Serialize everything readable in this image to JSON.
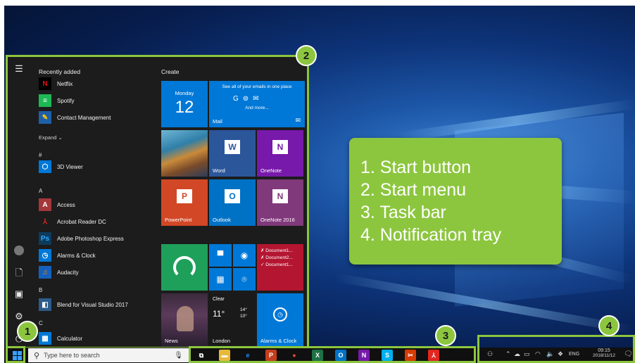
{
  "start_menu": {
    "recently_added": "Recently added",
    "create": "Create",
    "expand": "Expand",
    "apps": [
      {
        "label": "Netflix",
        "icon": "netflix-icon",
        "color": "#000000",
        "glyph": "N",
        "glyph_color": "#e50914"
      },
      {
        "label": "Spotify",
        "icon": "spotify-icon",
        "color": "#1db954",
        "glyph": "≡",
        "glyph_color": "#ffffff"
      },
      {
        "label": "Contact Management",
        "icon": "contact-management-icon",
        "color": "#1f5fa8",
        "glyph": "✎",
        "glyph_color": "#ffcc00"
      },
      {
        "label": "3D Viewer",
        "icon": "3d-viewer-icon",
        "color": "#0078d7",
        "glyph": "⬡",
        "glyph_color": "#ffffff"
      },
      {
        "label": "Access",
        "icon": "access-icon",
        "color": "#a4373a",
        "glyph": "A",
        "glyph_color": "#ffffff"
      },
      {
        "label": "Acrobat Reader DC",
        "icon": "acrobat-icon",
        "color": "#1c1c1c",
        "glyph": "⅄",
        "glyph_color": "#e3261f"
      },
      {
        "label": "Adobe Photoshop Express",
        "icon": "photoshop-express-icon",
        "color": "#0d3b5e",
        "glyph": "Ps",
        "glyph_color": "#31a8ff"
      },
      {
        "label": "Alarms & Clock",
        "icon": "alarm-clock-icon",
        "color": "#0078d7",
        "glyph": "◷",
        "glyph_color": "#ffffff"
      },
      {
        "label": "Audacity",
        "icon": "audacity-icon",
        "color": "#1560bd",
        "glyph": "♫",
        "glyph_color": "#ff8a00"
      },
      {
        "label": "Blend for Visual Studio 2017",
        "icon": "blend-icon",
        "color": "#2b5c8a",
        "glyph": "◧",
        "glyph_color": "#ffffff"
      },
      {
        "label": "Calculator",
        "icon": "calculator-icon",
        "color": "#0078d7",
        "glyph": "▦",
        "glyph_color": "#ffffff"
      }
    ],
    "letters": [
      "#",
      "A",
      "B",
      "C"
    ],
    "tiles": {
      "calendar": {
        "day_name": "Monday",
        "day_num": "12"
      },
      "mail": {
        "header": "See all of your emails in one place",
        "more": "And more...",
        "label": "Mail"
      },
      "word": "Word",
      "onenote": "OneNote",
      "powerpoint": "PowerPoint",
      "outlook": "Outlook",
      "onenote2016": "OneNote 2016",
      "documents": [
        "✗ Document1...",
        "✗ Document2...",
        "✓ Document1..."
      ],
      "weather": {
        "condition": "Clear",
        "temp": "11°",
        "high": "14°",
        "low": "10°",
        "city": "London"
      },
      "news": "News",
      "alarms": "Alarms & Clock"
    }
  },
  "taskbar": {
    "search_placeholder": "Type here to search",
    "apps": [
      {
        "name": "task-view-icon",
        "glyph": "⧉",
        "bg": "#101010",
        "fg": "#ffffff"
      },
      {
        "name": "file-explorer-icon",
        "glyph": "▬",
        "bg": "#e8b83a",
        "fg": "#ffffff"
      },
      {
        "name": "edge-icon",
        "glyph": "e",
        "bg": "#101010",
        "fg": "#1f8bff"
      },
      {
        "name": "powerpoint-taskbar-icon",
        "glyph": "P",
        "bg": "#c43e1c",
        "fg": "#ffffff"
      },
      {
        "name": "chrome-icon",
        "glyph": "●",
        "bg": "#101010",
        "fg": "#e8453c"
      },
      {
        "name": "excel-taskbar-icon",
        "glyph": "X",
        "bg": "#1e7145",
        "fg": "#ffffff"
      },
      {
        "name": "outlook-taskbar-icon",
        "glyph": "O",
        "bg": "#0072c6",
        "fg": "#ffffff"
      },
      {
        "name": "onenote-taskbar-icon",
        "glyph": "N",
        "bg": "#7719aa",
        "fg": "#ffffff"
      },
      {
        "name": "skype-icon",
        "glyph": "S",
        "bg": "#00aff0",
        "fg": "#ffffff"
      },
      {
        "name": "snipping-tool-icon",
        "glyph": "✂",
        "bg": "#d83b01",
        "fg": "#ffffff"
      },
      {
        "name": "acrobat-taskbar-icon",
        "glyph": "⅄",
        "bg": "#e3261f",
        "fg": "#ffffff"
      }
    ],
    "tray": {
      "lang": "ENG",
      "time": "09:15",
      "date": "2018/11/12"
    }
  },
  "callouts": {
    "badges": [
      "1",
      "2",
      "3",
      "4"
    ],
    "legend": [
      "1. Start button",
      "2. Start menu",
      "3. Task bar",
      "4. Notification tray"
    ]
  },
  "colors": {
    "callout_green": "#8cc63e",
    "accent_blue": "#0078d7"
  }
}
